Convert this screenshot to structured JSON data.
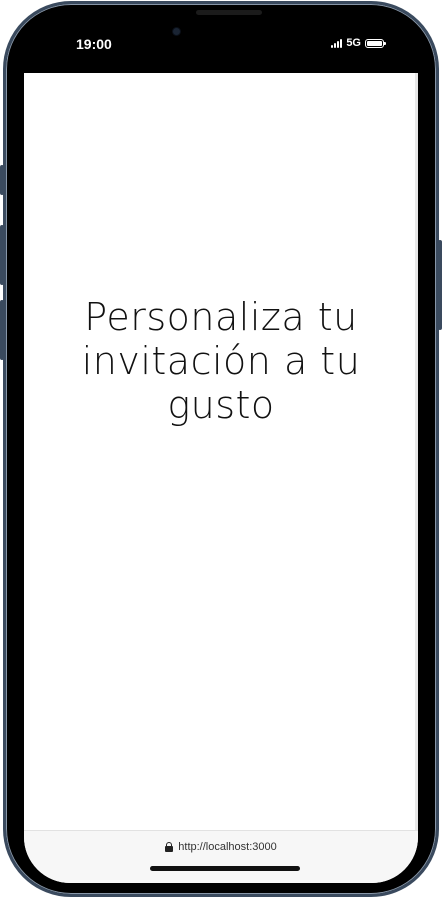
{
  "status_bar": {
    "time": "19:00",
    "network": "5G"
  },
  "main": {
    "title": "Personaliza tu invitación a tu gusto"
  },
  "browser": {
    "url": "http://localhost:3000",
    "secure_icon": "lock-icon"
  },
  "colors": {
    "frame": "#3a4a5e",
    "bezel": "#000000",
    "screen_background": "#ffffff",
    "text": "#111111",
    "url_bar_background": "#f7f7f7"
  }
}
